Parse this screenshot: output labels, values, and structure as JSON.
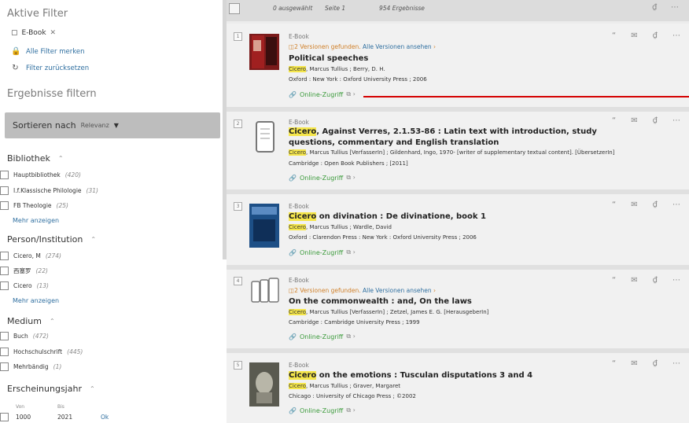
{
  "sidebar": {
    "active_filters_title": "Aktive Filter",
    "chip": "E-Book",
    "save_filters": "Alle Filter merken",
    "reset_filters": "Filter zurücksetzen",
    "refine_title": "Ergebnisse filtern",
    "sort_label": "Sortieren nach",
    "sort_value": "Relevanz",
    "bibliothek": {
      "title": "Bibliothek",
      "items": [
        {
          "label": "Hauptbibliothek",
          "count": "(420)"
        },
        {
          "label": "I.f.Klassische Philologie",
          "count": "(31)"
        },
        {
          "label": "FB Theologie",
          "count": "(25)"
        }
      ],
      "more": "Mehr anzeigen"
    },
    "person": {
      "title": "Person/Institution",
      "items": [
        {
          "label": "Cicero, M",
          "count": "(274)"
        },
        {
          "label": "西塞罗",
          "count": "(22)"
        },
        {
          "label": "Cicero",
          "count": "(13)"
        }
      ],
      "more": "Mehr anzeigen"
    },
    "medium": {
      "title": "Medium",
      "items": [
        {
          "label": "Buch",
          "count": "(472)"
        },
        {
          "label": "Hochschulschrift",
          "count": "(445)"
        },
        {
          "label": "Mehrbändig",
          "count": "(1)"
        }
      ]
    },
    "year": {
      "title": "Erscheinungsjahr",
      "from_label": "Von",
      "to_label": "Bis",
      "from": "1000",
      "to": "2021",
      "ok": "Ok"
    }
  },
  "toolbar": {
    "selected": "0 ausgewählt",
    "page": "Seite 1",
    "results": "954 Ergebnisse"
  },
  "records": [
    {
      "num": "1",
      "type": "E-Book",
      "versions": "2 Versionen gefunden.",
      "versions_link": "Alle Versionen ansehen",
      "title_pre": "",
      "title_hl": "",
      "title_post": "Political speeches",
      "auth_hl": "Cicero",
      "auth_rest": ", Marcus Tullius ; Berry, D. H.",
      "pub": "Oxford : New York : Oxford University Press ; 2006",
      "online": "Online-Zugriff"
    },
    {
      "num": "2",
      "type": "E-Book",
      "title_pre": "",
      "title_hl": "Cicero",
      "title_post": ", Against Verres, 2.1.53-86 : Latin text with introduction, study questions, commentary and English translation",
      "auth_hl": "Cicero",
      "auth_rest": ", Marcus Tullius [VerfasserIn] ; Gildenhard, Ingo, 1970- [writer of supplementary textual content]. [ÜbersetzerIn]",
      "pub": "Cambridge : Open Book Publishers ; [2011]",
      "online": "Online-Zugriff"
    },
    {
      "num": "3",
      "type": "E-Book",
      "title_pre": "",
      "title_hl": "Cicero",
      "title_post": " on divination : De divinatione, book 1",
      "auth_hl": "Cicero",
      "auth_rest": ", Marcus Tullius ; Wardle, David",
      "pub": "Oxford : Clarendon Press : New York : Oxford University Press ; 2006",
      "online": "Online-Zugriff"
    },
    {
      "num": "4",
      "type": "E-Book",
      "versions": "2 Versionen gefunden.",
      "versions_link": "Alle Versionen ansehen",
      "title_pre": "",
      "title_hl": "",
      "title_post": "On the commonwealth : and, On the laws",
      "auth_hl": "Cicero",
      "auth_rest": ", Marcus Tullius [VerfasserIn] ; Zetzel, James E. G. [HerausgeberIn]",
      "pub": "Cambridge : Cambridge University Press ; 1999",
      "online": "Online-Zugriff"
    },
    {
      "num": "5",
      "type": "E-Book",
      "title_pre": "",
      "title_hl": "Cicero",
      "title_post": " on the emotions : Tusculan disputations 3 and 4",
      "auth_hl": "Cicero",
      "auth_rest": ", Marcus Tullius ; Graver, Margaret",
      "pub": "Chicago : University of Chicago Press ; ©2002",
      "online": "Online-Zugriff"
    }
  ]
}
